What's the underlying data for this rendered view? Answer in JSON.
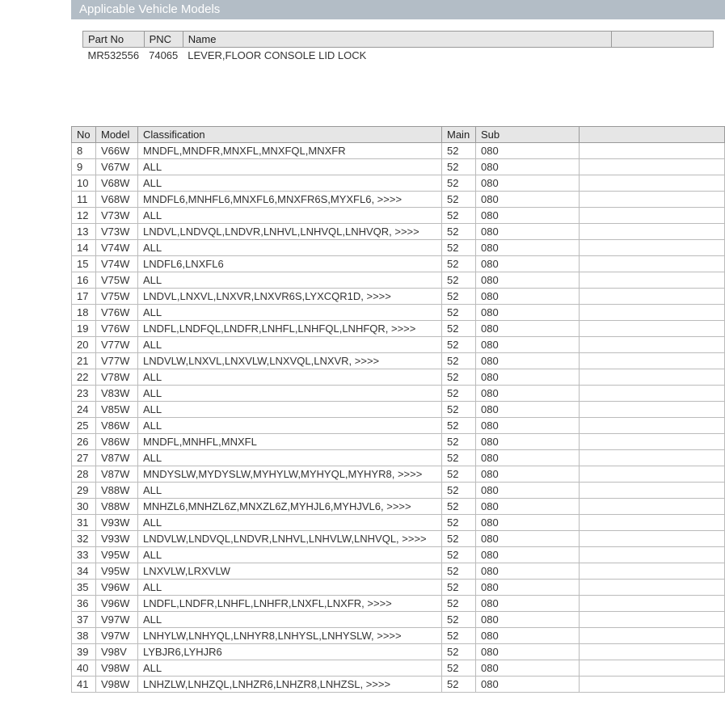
{
  "header": {
    "title": "Applicable Vehicle Models"
  },
  "part": {
    "columns": {
      "partNo": "Part No",
      "pnc": "PNC",
      "name": "Name"
    },
    "row": {
      "partNo": "MR532556",
      "pnc": "74065",
      "name": "LEVER,FLOOR CONSOLE LID LOCK"
    }
  },
  "models": {
    "columns": {
      "no": "No",
      "model": "Model",
      "classification": "Classification",
      "main": "Main",
      "sub": "Sub"
    },
    "rows": [
      {
        "no": "8",
        "model": "V66W",
        "classification": "MNDFL,MNDFR,MNXFL,MNXFQL,MNXFR",
        "main": "52",
        "sub": "080"
      },
      {
        "no": "9",
        "model": "V67W",
        "classification": "ALL",
        "main": "52",
        "sub": "080"
      },
      {
        "no": "10",
        "model": "V68W",
        "classification": "ALL",
        "main": "52",
        "sub": "080"
      },
      {
        "no": "11",
        "model": "V68W",
        "classification": "MNDFL6,MNHFL6,MNXFL6,MNXFR6S,MYXFL6,   >>>>",
        "main": "52",
        "sub": "080"
      },
      {
        "no": "12",
        "model": "V73W",
        "classification": "ALL",
        "main": "52",
        "sub": "080"
      },
      {
        "no": "13",
        "model": "V73W",
        "classification": "LNDVL,LNDVQL,LNDVR,LNHVL,LNHVQL,LNHVQR,   >>>>",
        "main": "52",
        "sub": "080"
      },
      {
        "no": "14",
        "model": "V74W",
        "classification": "ALL",
        "main": "52",
        "sub": "080"
      },
      {
        "no": "15",
        "model": "V74W",
        "classification": "LNDFL6,LNXFL6",
        "main": "52",
        "sub": "080"
      },
      {
        "no": "16",
        "model": "V75W",
        "classification": "ALL",
        "main": "52",
        "sub": "080"
      },
      {
        "no": "17",
        "model": "V75W",
        "classification": "LNDVL,LNXVL,LNXVR,LNXVR6S,LYXCQR1D,   >>>>",
        "main": "52",
        "sub": "080"
      },
      {
        "no": "18",
        "model": "V76W",
        "classification": "ALL",
        "main": "52",
        "sub": "080"
      },
      {
        "no": "19",
        "model": "V76W",
        "classification": "LNDFL,LNDFQL,LNDFR,LNHFL,LNHFQL,LNHFQR,   >>>>",
        "main": "52",
        "sub": "080"
      },
      {
        "no": "20",
        "model": "V77W",
        "classification": "ALL",
        "main": "52",
        "sub": "080"
      },
      {
        "no": "21",
        "model": "V77W",
        "classification": "LNDVLW,LNXVL,LNXVLW,LNXVQL,LNXVR,   >>>>",
        "main": "52",
        "sub": "080"
      },
      {
        "no": "22",
        "model": "V78W",
        "classification": "ALL",
        "main": "52",
        "sub": "080"
      },
      {
        "no": "23",
        "model": "V83W",
        "classification": "ALL",
        "main": "52",
        "sub": "080"
      },
      {
        "no": "24",
        "model": "V85W",
        "classification": "ALL",
        "main": "52",
        "sub": "080"
      },
      {
        "no": "25",
        "model": "V86W",
        "classification": "ALL",
        "main": "52",
        "sub": "080"
      },
      {
        "no": "26",
        "model": "V86W",
        "classification": "MNDFL,MNHFL,MNXFL",
        "main": "52",
        "sub": "080"
      },
      {
        "no": "27",
        "model": "V87W",
        "classification": "ALL",
        "main": "52",
        "sub": "080"
      },
      {
        "no": "28",
        "model": "V87W",
        "classification": "MNDYSLW,MYDYSLW,MYHYLW,MYHYQL,MYHYR8,   >>>>",
        "main": "52",
        "sub": "080"
      },
      {
        "no": "29",
        "model": "V88W",
        "classification": "ALL",
        "main": "52",
        "sub": "080"
      },
      {
        "no": "30",
        "model": "V88W",
        "classification": "MNHZL6,MNHZL6Z,MNXZL6Z,MYHJL6,MYHJVL6,   >>>>",
        "main": "52",
        "sub": "080"
      },
      {
        "no": "31",
        "model": "V93W",
        "classification": "ALL",
        "main": "52",
        "sub": "080"
      },
      {
        "no": "32",
        "model": "V93W",
        "classification": "LNDVLW,LNDVQL,LNDVR,LNHVL,LNHVLW,LNHVQL,   >>>>",
        "main": "52",
        "sub": "080"
      },
      {
        "no": "33",
        "model": "V95W",
        "classification": "ALL",
        "main": "52",
        "sub": "080"
      },
      {
        "no": "34",
        "model": "V95W",
        "classification": "LNXVLW,LRXVLW",
        "main": "52",
        "sub": "080"
      },
      {
        "no": "35",
        "model": "V96W",
        "classification": "ALL",
        "main": "52",
        "sub": "080"
      },
      {
        "no": "36",
        "model": "V96W",
        "classification": "LNDFL,LNDFR,LNHFL,LNHFR,LNXFL,LNXFR,   >>>>",
        "main": "52",
        "sub": "080"
      },
      {
        "no": "37",
        "model": "V97W",
        "classification": "ALL",
        "main": "52",
        "sub": "080"
      },
      {
        "no": "38",
        "model": "V97W",
        "classification": "LNHYLW,LNHYQL,LNHYR8,LNHYSL,LNHYSLW,   >>>>",
        "main": "52",
        "sub": "080"
      },
      {
        "no": "39",
        "model": "V98V",
        "classification": "LYBJR6,LYHJR6",
        "main": "52",
        "sub": "080"
      },
      {
        "no": "40",
        "model": "V98W",
        "classification": "ALL",
        "main": "52",
        "sub": "080"
      },
      {
        "no": "41",
        "model": "V98W",
        "classification": "LNHZLW,LNHZQL,LNHZR6,LNHZR8,LNHZSL,   >>>>",
        "main": "52",
        "sub": "080"
      }
    ]
  }
}
